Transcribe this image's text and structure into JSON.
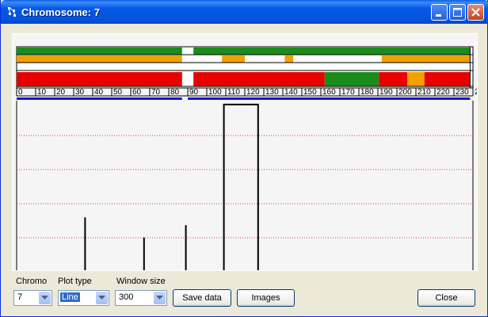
{
  "window": {
    "title": "Chromosome: 7"
  },
  "controls": {
    "chromo_label": "Chromo",
    "chromo_value": "7",
    "plot_type_label": "Plot type",
    "plot_type_value": "Line",
    "window_size_label": "Window size",
    "window_size_value": "300",
    "save_data_label": "Save data",
    "images_label": "Images",
    "close_label": "Close"
  },
  "chart_data": {
    "type": "line",
    "x_axis_ticks": [
      "0",
      "10",
      "20",
      "30",
      "40",
      "50",
      "60",
      "70",
      "80",
      "90",
      "100",
      "110",
      "120",
      "130",
      "140",
      "150",
      "160",
      "170",
      "180",
      "190",
      "200",
      "210",
      "220",
      "230",
      "24"
    ],
    "xlim": [
      0,
      245
    ],
    "chromosome_length": 159,
    "grid": "horizontal dotted red",
    "annotation_tracks": [
      {
        "name": "track-1",
        "segments": [
          {
            "start": 0,
            "end": 58,
            "color": "#1A8C1A"
          },
          {
            "start": 62,
            "end": 159,
            "color": "#1A8C1A"
          }
        ]
      },
      {
        "name": "track-2",
        "segments": [
          {
            "start": 0,
            "end": 58,
            "color": "#F0A000"
          },
          {
            "start": 72,
            "end": 80,
            "color": "#F0A000"
          },
          {
            "start": 94,
            "end": 97,
            "color": "#F0A000"
          },
          {
            "start": 128,
            "end": 159,
            "color": "#F0A000"
          }
        ]
      },
      {
        "name": "track-3",
        "segments": []
      },
      {
        "name": "track-4",
        "segments": [
          {
            "start": 0,
            "end": 58,
            "color": "#E80000"
          },
          {
            "start": 62,
            "end": 108,
            "color": "#E80000"
          },
          {
            "start": 108,
            "end": 127,
            "color": "#1A8C1A"
          },
          {
            "start": 127,
            "end": 137,
            "color": "#E80000"
          },
          {
            "start": 137,
            "end": 143,
            "color": "#F0A000"
          },
          {
            "start": 143,
            "end": 159,
            "color": "#E80000"
          }
        ]
      }
    ],
    "blue_segments": [
      {
        "start": 0,
        "end": 58
      },
      {
        "start": 60,
        "end": 159
      }
    ],
    "series": [
      {
        "values": [
          [
            35,
            0
          ],
          [
            36,
            0
          ],
          [
            36,
            70
          ],
          [
            36,
            0
          ],
          [
            66,
            0
          ],
          [
            67,
            0
          ],
          [
            67,
            44
          ],
          [
            67,
            0
          ],
          [
            88,
            0
          ],
          [
            89,
            0
          ],
          [
            89,
            60
          ],
          [
            89,
            0
          ],
          [
            108,
            0
          ],
          [
            109,
            0
          ],
          [
            109,
            130
          ],
          [
            109,
            215
          ],
          [
            127,
            215
          ],
          [
            127,
            0
          ],
          [
            128,
            0
          ]
        ]
      }
    ],
    "ylim": [
      0,
      220
    ]
  },
  "colors": {
    "accent": "#316AC5",
    "grid": "#E04040"
  }
}
